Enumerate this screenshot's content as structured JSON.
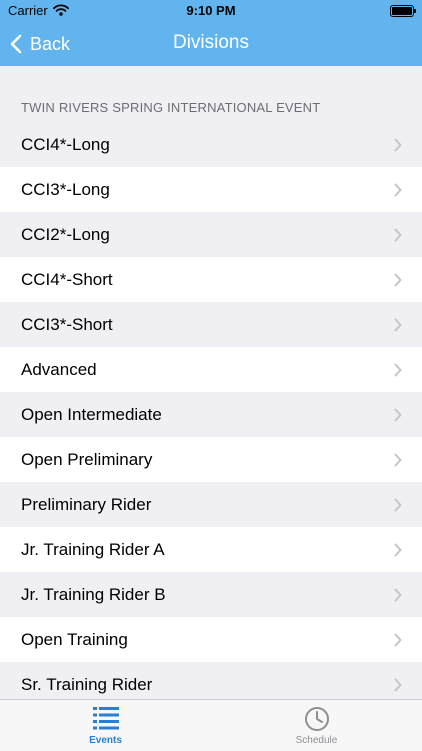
{
  "status_bar": {
    "carrier": "Carrier",
    "time": "9:10 PM"
  },
  "nav": {
    "back_label": "Back",
    "title": "Divisions"
  },
  "section_header": "TWIN RIVERS SPRING INTERNATIONAL EVENT",
  "divisions": [
    "CCI4*-Long",
    "CCI3*-Long",
    "CCI2*-Long",
    "CCI4*-Short",
    "CCI3*-Short",
    "Advanced",
    "Open Intermediate",
    "Open Preliminary",
    "Preliminary Rider",
    "Jr. Training Rider A",
    "Jr. Training Rider B",
    "Open Training",
    "Sr. Training Rider"
  ],
  "tabs": {
    "events": "Events",
    "schedule": "Schedule"
  },
  "colors": {
    "nav_bar": "#62b4ee",
    "tab_active": "#2a7fd4",
    "tab_inactive": "#8e8e93"
  },
  "icons": {
    "back": "chevron-left-icon",
    "row": "chevron-right-icon",
    "events_tab": "list-icon",
    "schedule_tab": "clock-icon"
  }
}
